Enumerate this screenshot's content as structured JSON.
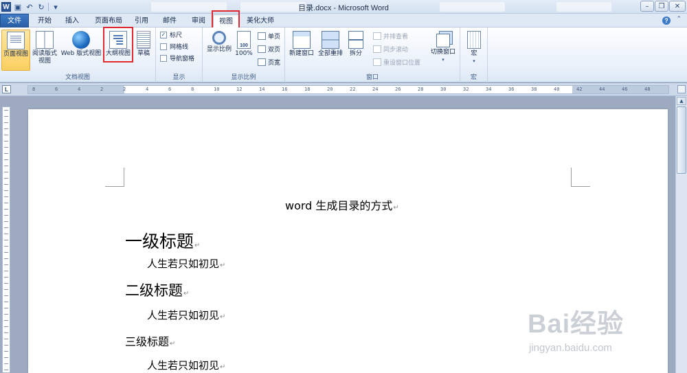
{
  "window": {
    "title": "目录.docx - Microsoft Word",
    "app_logo": "W"
  },
  "tabs": [
    {
      "label": "文件"
    },
    {
      "label": "开始"
    },
    {
      "label": "插入"
    },
    {
      "label": "页面布局"
    },
    {
      "label": "引用"
    },
    {
      "label": "邮件"
    },
    {
      "label": "审阅"
    },
    {
      "label": "视图"
    },
    {
      "label": "美化大师"
    }
  ],
  "active_tab": "视图",
  "ribbon": {
    "doc_views": {
      "label": "文档视图",
      "print_layout": "页面视图",
      "reading_line1": "阅读版式",
      "reading_line2": "视图",
      "web_layout": "Web 版式视图",
      "outline": "大纲视图",
      "draft": "草稿"
    },
    "show": {
      "label": "显示",
      "ruler": "标尺",
      "gridlines": "网格线",
      "nav_pane": "导航窗格"
    },
    "zoom": {
      "label": "显示比例",
      "zoom": "显示比例",
      "percent": "100%",
      "one_page": "单页",
      "two_pages": "双页",
      "page_width": "页宽"
    },
    "window": {
      "label": "窗口",
      "new_window": "新建窗口",
      "arrange_all": "全部重排",
      "split": "拆分",
      "side_by_side": "并排查看",
      "sync_scroll": "同步滚动",
      "reset_pos": "重设窗口位置",
      "switch_windows": "切换窗口"
    },
    "macros": {
      "label": "宏",
      "macros": "宏"
    }
  },
  "ruler_ticks": [
    "8",
    "6",
    "4",
    "2",
    "2",
    "4",
    "6",
    "8",
    "10",
    "12",
    "14",
    "16",
    "18",
    "20",
    "22",
    "24",
    "26",
    "28",
    "30",
    "32",
    "34",
    "36",
    "38",
    "40",
    "42",
    "44",
    "46",
    "48"
  ],
  "document": {
    "title": "word 生成目录的方式",
    "heading1": "一级标题",
    "body1": "人生若只如初见",
    "heading2": "二级标题",
    "body2": "人生若只如初见",
    "heading3": "三级标题",
    "body3": "人生若只如初见"
  },
  "watermark": {
    "brand": "Bai经验",
    "url": "jingyan.baidu.com"
  },
  "colors": {
    "file_tab": "#2a5fa6",
    "highlight": "#e0282e",
    "pressed": "#fccf5f"
  }
}
